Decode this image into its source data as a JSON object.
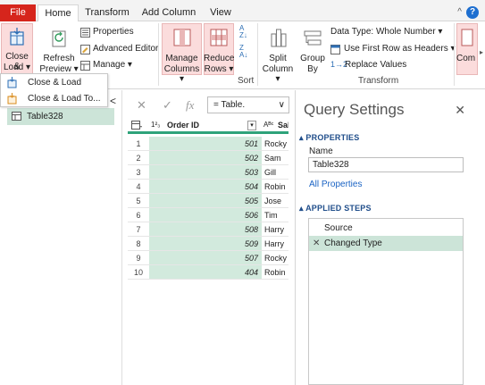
{
  "tabs": {
    "file": "File",
    "home": "Home",
    "transform": "Transform",
    "add_column": "Add Column",
    "view": "View"
  },
  "window": {
    "collapse_ribbon": "^",
    "help": "?"
  },
  "ribbon": {
    "close_load": {
      "line1": "Close &",
      "line2": "Load ▾"
    },
    "refresh_preview": {
      "line1": "Refresh",
      "line2": "Preview ▾"
    },
    "properties": "Properties",
    "advanced_editor": "Advanced Editor",
    "manage": "Manage ▾",
    "manage_columns": {
      "line1": "Manage",
      "line2": "Columns ▾"
    },
    "reduce_rows": {
      "line1": "Reduce",
      "line2": "Rows ▾"
    },
    "sort_group": "Sort",
    "split_column": {
      "line1": "Split",
      "line2": "Column ▾"
    },
    "group_by": {
      "line1": "Group",
      "line2": "By"
    },
    "data_type": "Data Type: Whole Number ▾",
    "first_row_headers": "Use First Row as Headers ▾",
    "replace_values": "Replace Values",
    "transform_group": "Transform",
    "combine": "Com"
  },
  "close_load_menu": {
    "items": [
      "Close & Load",
      "Close & Load To..."
    ]
  },
  "queries": {
    "collapse": "<",
    "items": [
      "Table328"
    ]
  },
  "formula_bar": {
    "cancel": "✕",
    "commit": "✓",
    "fx": "fx",
    "formula": "= Table.",
    "expand": "∨"
  },
  "grid": {
    "columns": [
      {
        "type": "1²₃",
        "label": "Order ID"
      },
      {
        "type": "Aᴮᶜ",
        "label": "Sal"
      }
    ],
    "rows": [
      {
        "idx": "1",
        "order_id": "501",
        "name": "Rocky"
      },
      {
        "idx": "2",
        "order_id": "502",
        "name": "Sam"
      },
      {
        "idx": "3",
        "order_id": "503",
        "name": "Gill"
      },
      {
        "idx": "4",
        "order_id": "504",
        "name": "Robin"
      },
      {
        "idx": "5",
        "order_id": "505",
        "name": "Jose"
      },
      {
        "idx": "6",
        "order_id": "506",
        "name": "Tim"
      },
      {
        "idx": "7",
        "order_id": "508",
        "name": "Harry"
      },
      {
        "idx": "8",
        "order_id": "509",
        "name": "Harry"
      },
      {
        "idx": "9",
        "order_id": "507",
        "name": "Rocky"
      },
      {
        "idx": "10",
        "order_id": "404",
        "name": "Robin"
      }
    ]
  },
  "query_settings": {
    "title": "Query Settings",
    "close": "✕",
    "properties_heading": "▴ PROPERTIES",
    "name_label": "Name",
    "name_value": "Table328",
    "all_properties": "All Properties",
    "steps_heading": "▴ APPLIED STEPS",
    "steps": [
      "Source",
      "Changed Type"
    ]
  },
  "colors": {
    "file_tab": "#d6251c",
    "accent_green": "#2ea37a",
    "selection_green": "#cce4d8",
    "link_blue": "#1a63c4",
    "heading_blue": "#1f4d8a"
  }
}
